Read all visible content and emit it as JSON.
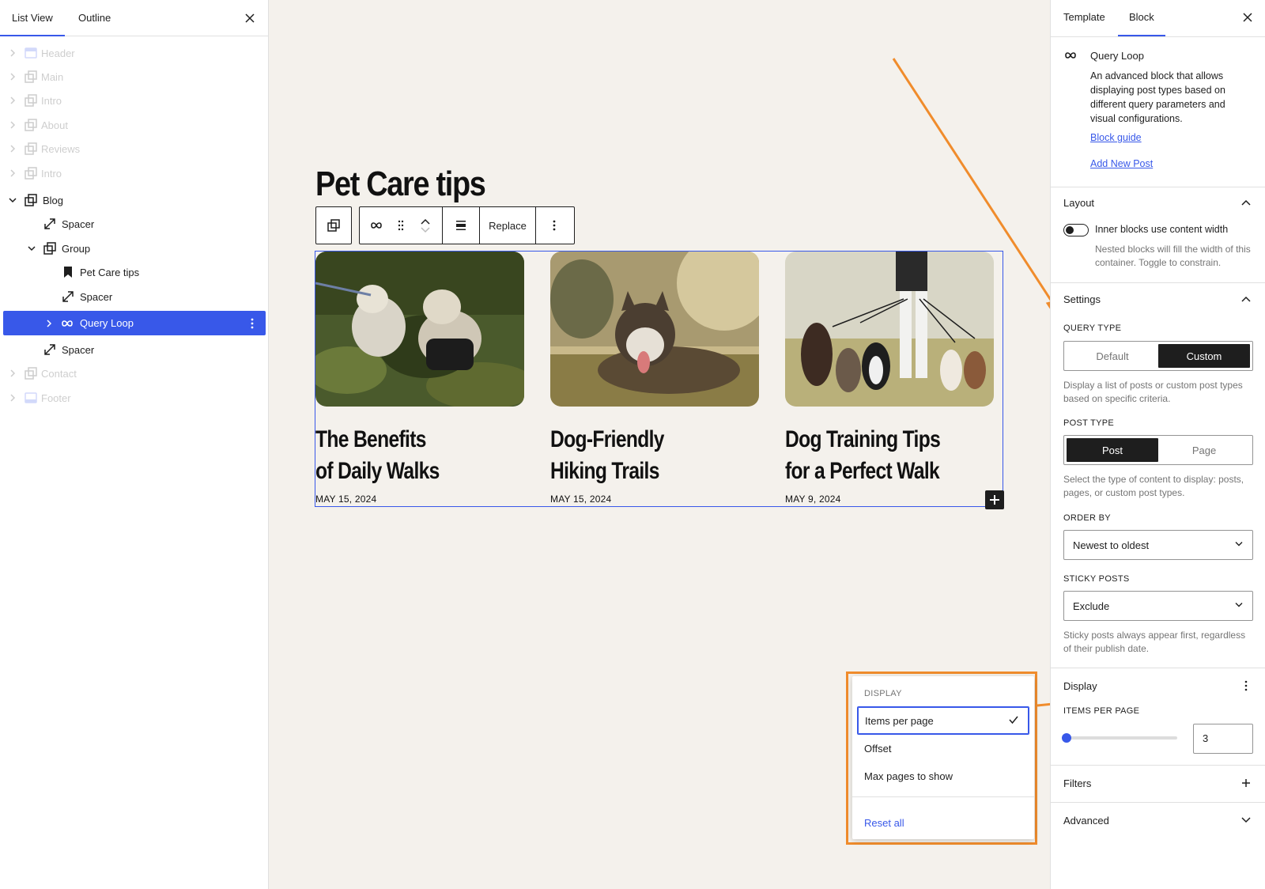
{
  "left_panel": {
    "tabs": [
      "List View",
      "Outline"
    ],
    "tree": [
      {
        "label": "Header",
        "faded": true
      },
      {
        "label": "Main",
        "faded": true
      },
      {
        "label": "Intro",
        "faded": true
      },
      {
        "label": "About",
        "faded": true
      },
      {
        "label": "Reviews",
        "faded": true
      },
      {
        "label": "Intro",
        "faded": true
      },
      {
        "label": "Blog"
      },
      {
        "label": "Spacer"
      },
      {
        "label": "Group"
      },
      {
        "label": "Pet Care tips"
      },
      {
        "label": "Spacer"
      },
      {
        "label": "Query Loop",
        "selected": true
      },
      {
        "label": "Spacer"
      },
      {
        "label": "Contact",
        "faded": true
      },
      {
        "label": "Footer",
        "faded": true
      }
    ]
  },
  "canvas": {
    "page_title": "Pet Care tips",
    "toolbar": {
      "replace_label": "Replace"
    },
    "posts": [
      {
        "title_line1": "The Benefits",
        "title_line2": "of Daily Walks",
        "date": "MAY 15, 2024"
      },
      {
        "title_line1": "Dog-Friendly",
        "title_line2": "Hiking Trails",
        "date": "MAY 15, 2024"
      },
      {
        "title_line1": "Dog Training Tips",
        "title_line2": "for a Perfect Walk",
        "date": "MAY 9, 2024"
      }
    ]
  },
  "popover": {
    "heading": "DISPLAY",
    "items": [
      "Items per page",
      "Offset",
      "Max pages to show"
    ],
    "selected": "Items per page",
    "reset_label": "Reset all"
  },
  "right_panel": {
    "tabs": [
      "Template",
      "Block"
    ],
    "block": {
      "name": "Query Loop",
      "description": "An advanced block that allows displaying post types based on different query parameters and visual configurations.",
      "guide_link": "Block guide",
      "new_post_link": "Add New Post"
    },
    "layout": {
      "title": "Layout",
      "toggle_label": "Inner blocks use content width",
      "toggle_help": "Nested blocks will fill the width of this container. Toggle to constrain."
    },
    "settings": {
      "title": "Settings",
      "query_type_label": "QUERY TYPE",
      "query_type_options": [
        "Default",
        "Custom"
      ],
      "query_type_selected": "Custom",
      "query_type_help": "Display a list of posts or custom post types based on specific criteria.",
      "post_type_label": "POST TYPE",
      "post_type_options": [
        "Post",
        "Page"
      ],
      "post_type_selected": "Post",
      "post_type_help": "Select the type of content to display: posts, pages, or custom post types.",
      "order_by_label": "ORDER BY",
      "order_by_value": "Newest to oldest",
      "sticky_label": "STICKY POSTS",
      "sticky_value": "Exclude",
      "sticky_help": "Sticky posts always appear first, regardless of their publish date."
    },
    "display": {
      "title": "Display",
      "items_per_page_label": "ITEMS PER PAGE",
      "items_per_page_value": "3"
    },
    "filters": {
      "title": "Filters"
    },
    "advanced": {
      "title": "Advanced"
    }
  },
  "colors": {
    "accent": "#3858e9",
    "annotation": "#f08c2c",
    "canvas_bg": "#f4f1ec",
    "dark": "#1e1e1e"
  }
}
